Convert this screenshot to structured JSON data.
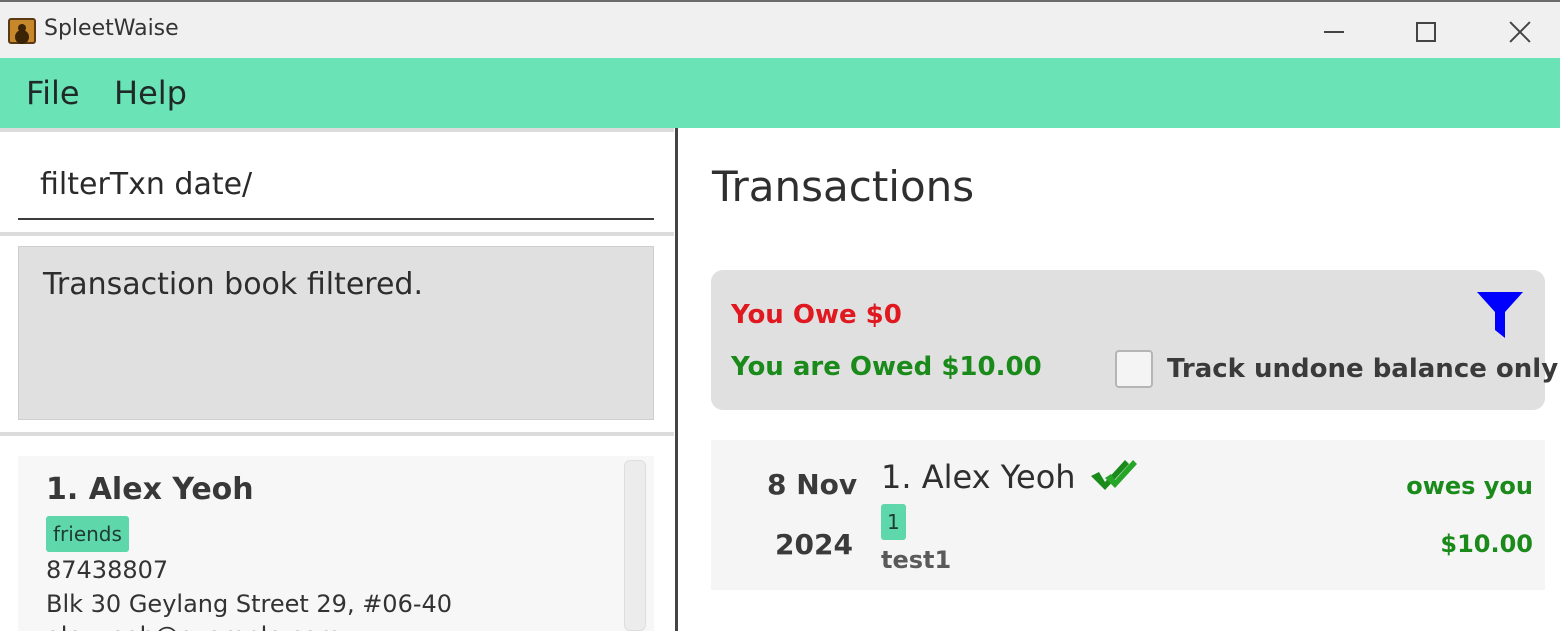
{
  "window": {
    "title": "SpleetWaise"
  },
  "menu": {
    "file_label": "File",
    "help_label": "Help"
  },
  "command": {
    "value": "filterTxn date/"
  },
  "result": {
    "message": "Transaction book filtered."
  },
  "persons": [
    {
      "name": "1. Alex Yeoh",
      "tag": "friends",
      "phone": "87438807",
      "address": "Blk 30 Geylang Street 29, #06-40",
      "email": "alexyeoh@example.com"
    }
  ],
  "transactions_panel": {
    "title": "Transactions",
    "you_owe": "You Owe $0",
    "you_are_owed": "You are Owed $10.00",
    "track_undone_label": "Track undone balance only",
    "track_undone_checked": false,
    "filter_icon": "funnel-icon",
    "filter_icon_color": "#0000ff"
  },
  "transactions": [
    {
      "day": "8 Nov",
      "year": "2024",
      "person": "1. Alex Yeoh",
      "done": true,
      "done_icon": "double-check-icon",
      "tag": "1",
      "description": "test1",
      "status": "owes you",
      "amount": "$10.00"
    }
  ],
  "colors": {
    "menubar": "#6ae3b6",
    "tag": "#5ed7aa",
    "owe_red": "#e0181f",
    "owed_green": "#1a8a1a"
  }
}
